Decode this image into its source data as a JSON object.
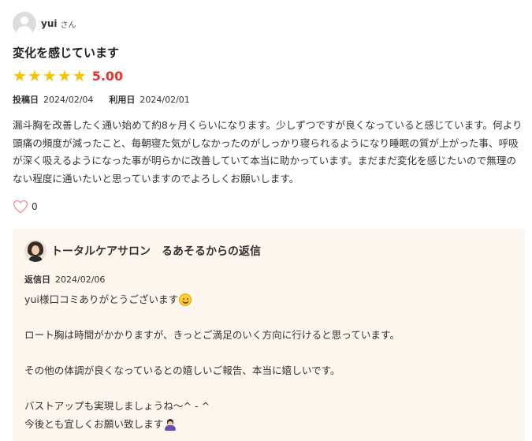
{
  "reviewer": {
    "name": "yui",
    "suffix": "さん"
  },
  "review": {
    "title": "変化を感じています",
    "stars": 5,
    "score": "5.00",
    "posted_label": "投稿日",
    "posted_date": "2024/02/04",
    "used_label": "利用日",
    "used_date": "2024/02/01",
    "body": "漏斗胸を改善したく通い始めて約8ヶ月くらいになります。少しずつですが良くなっていると感じています。何より頭痛の頻度が減ったこと、毎朝寝た気がしなかったのがしっかり寝られるようになり睡眠の質が上がった事、呼吸が深く吸えるようになった事が明らかに改善していて本当に助かっています。まだまだ変化を感じたいので無理のない程度に通いたいと思っていますのでよろしくお願いします。",
    "like_count": "0"
  },
  "reply": {
    "title": "トータルケアサロン　るあそるからの返信",
    "date_label": "返信日",
    "date": "2024/02/06",
    "lines": [
      "yui様口コミありがとうございます",
      "",
      "ロート胸は時間がかかりますが、きっとご満足のいく方向に行けると思っています。",
      "",
      "その他の体調が良くなっているとの嬉しいご報告、本当に嬉しいです。",
      "",
      "バストアップも実現しましょうね〜^ - ^",
      "今後とも宜しくお願い致します"
    ]
  },
  "colors": {
    "star": "#f5c400",
    "score": "#e8332b",
    "reply_bg": "#fdf6ee",
    "heart_outline": "#f08a9a"
  },
  "icons": {
    "avatar": "default-user-avatar",
    "star": "star-icon",
    "like": "heart-outline-icon",
    "salon_avatar": "salon-staff-photo",
    "smile": "smiling-face-emoji",
    "person": "person-bowing-emoji"
  }
}
